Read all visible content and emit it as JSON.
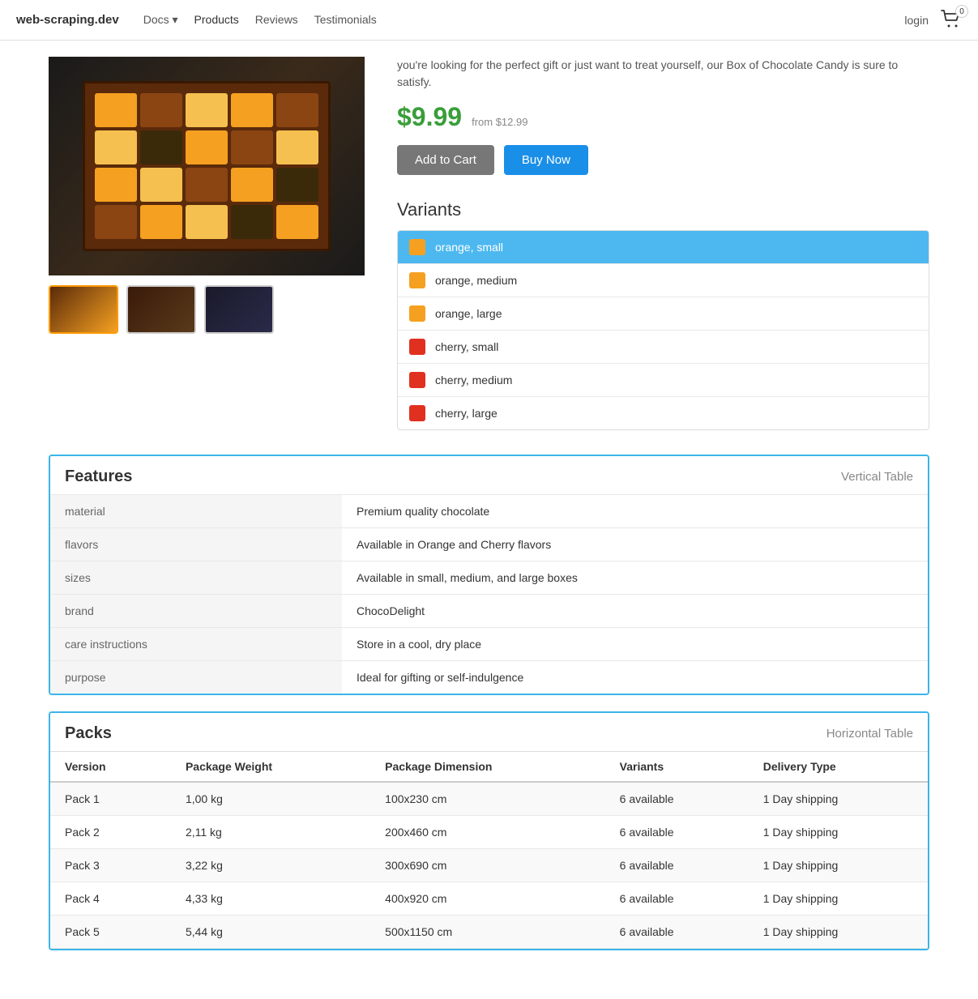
{
  "nav": {
    "brand": "web-scraping.dev",
    "links": [
      {
        "label": "Docs",
        "href": "#",
        "hasDropdown": true,
        "active": false
      },
      {
        "label": "Products",
        "href": "#",
        "active": true
      },
      {
        "label": "Reviews",
        "href": "#",
        "active": false
      },
      {
        "label": "Testimonials",
        "href": "#",
        "active": false
      }
    ],
    "login": "login",
    "cartCount": "0"
  },
  "product": {
    "description": "you're looking for the perfect gift or just want to treat yourself, our Box of Chocolate Candy is sure to satisfy.",
    "price": "$9.99",
    "priceFrom": "from $12.99",
    "addToCart": "Add to Cart",
    "buyNow": "Buy Now"
  },
  "variants": {
    "title": "Variants",
    "items": [
      {
        "label": "orange, small",
        "color": "#f5a020",
        "selected": true
      },
      {
        "label": "orange, medium",
        "color": "#f5a020",
        "selected": false
      },
      {
        "label": "orange, large",
        "color": "#f5a020",
        "selected": false
      },
      {
        "label": "cherry, small",
        "color": "#e03020",
        "selected": false
      },
      {
        "label": "cherry, medium",
        "color": "#e03020",
        "selected": false
      },
      {
        "label": "cherry, large",
        "color": "#e03020",
        "selected": false
      }
    ]
  },
  "features": {
    "title": "Features",
    "tableType": "Vertical Table",
    "rows": [
      {
        "key": "material",
        "value": "Premium quality chocolate"
      },
      {
        "key": "flavors",
        "value": "Available in Orange and Cherry flavors"
      },
      {
        "key": "sizes",
        "value": "Available in small, medium, and large boxes"
      },
      {
        "key": "brand",
        "value": "ChocoDelight"
      },
      {
        "key": "care instructions",
        "value": "Store in a cool, dry place"
      },
      {
        "key": "purpose",
        "value": "Ideal for gifting or self-indulgence"
      }
    ]
  },
  "packs": {
    "title": "Packs",
    "tableType": "Horizontal Table",
    "columns": [
      "Version",
      "Package Weight",
      "Package Dimension",
      "Variants",
      "Delivery Type"
    ],
    "rows": [
      {
        "version": "Pack 1",
        "weight": "1,00 kg",
        "dimension": "100x230 cm",
        "variants": "6 available",
        "delivery": "1 Day shipping"
      },
      {
        "version": "Pack 2",
        "weight": "2,11 kg",
        "dimension": "200x460 cm",
        "variants": "6 available",
        "delivery": "1 Day shipping"
      },
      {
        "version": "Pack 3",
        "weight": "3,22 kg",
        "dimension": "300x690 cm",
        "variants": "6 available",
        "delivery": "1 Day shipping"
      },
      {
        "version": "Pack 4",
        "weight": "4,33 kg",
        "dimension": "400x920 cm",
        "variants": "6 available",
        "delivery": "1 Day shipping"
      },
      {
        "version": "Pack 5",
        "weight": "5,44 kg",
        "dimension": "500x1150 cm",
        "variants": "6 available",
        "delivery": "1 Day shipping"
      }
    ]
  },
  "chocolatePieces": [
    "#f5a020",
    "#8B4513",
    "#f5c050",
    "#f5a020",
    "#8B4513",
    "#f5c050",
    "#3a2a0a",
    "#f5a020",
    "#8B4513",
    "#f5c050",
    "#f5a020",
    "#f5c050",
    "#8B4513",
    "#f5a020",
    "#3a2a0a",
    "#8B4513",
    "#f5a020",
    "#f5c050",
    "#3a2a0a",
    "#f5a020"
  ]
}
